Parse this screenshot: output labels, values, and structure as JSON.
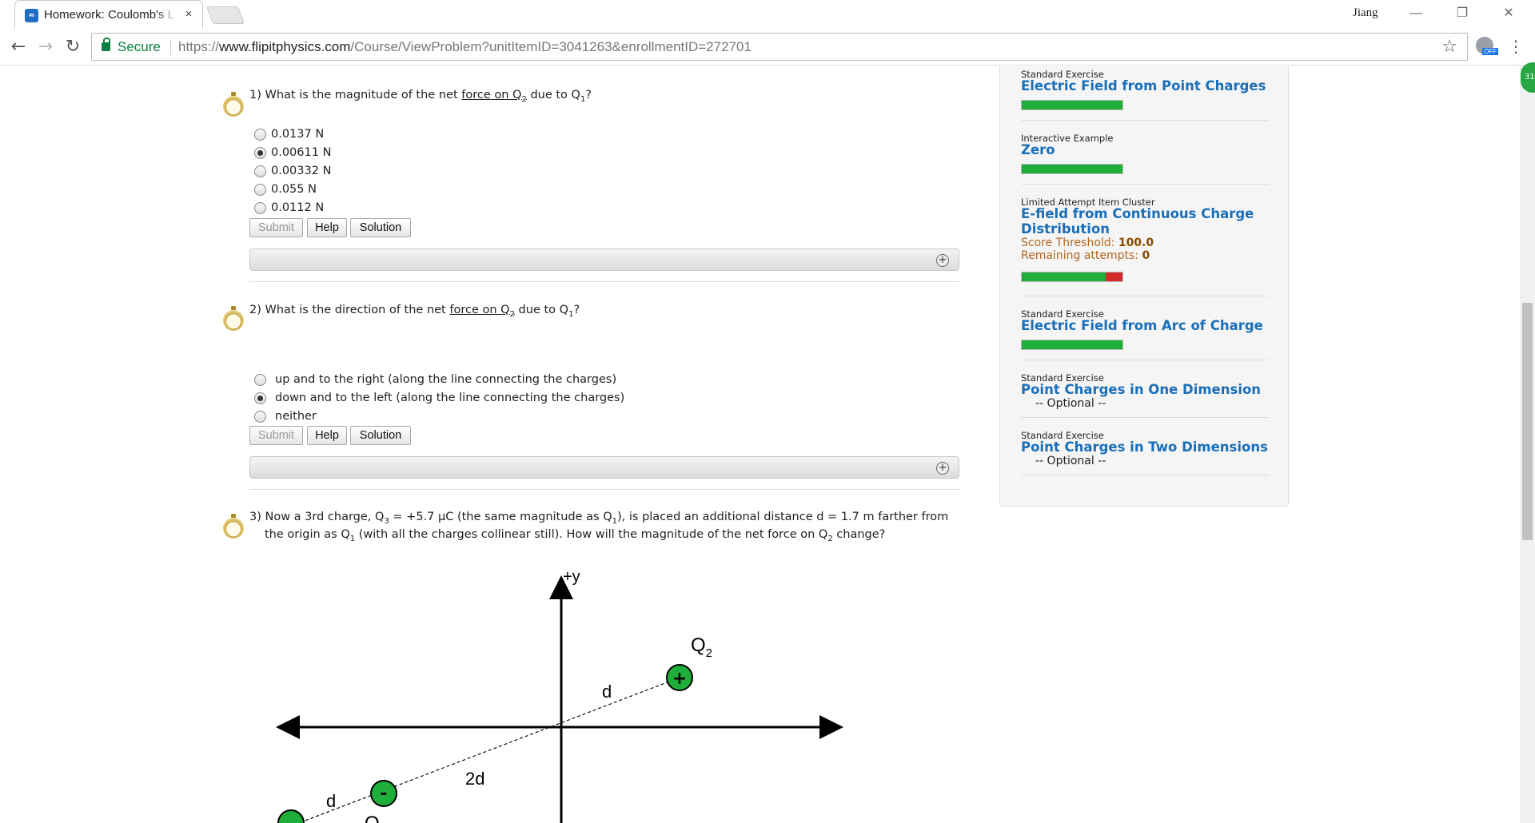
{
  "browser": {
    "tab_title": "Homework: Coulomb's L",
    "tab_close": "×",
    "user": "Jiang",
    "minimize": "—",
    "restore": "❐",
    "close": "✕",
    "secure_label": "Secure",
    "url_scheme": "https://",
    "url_host": "www.flipitphysics.com",
    "url_path": "/Course/ViewProblem?unitItemID=3041263&enrollmentID=272701",
    "extension_off": "OFF",
    "notification_count": "31"
  },
  "questions": [
    {
      "number": "1)",
      "text_pre": "What is the magnitude of the net ",
      "link": "force on Q",
      "link_sub": "2",
      "text_mid": " due to Q",
      "text_sub": "1",
      "text_post": "?",
      "options": [
        "0.0137 N",
        "0.00611 N",
        "0.00332 N",
        "0.055 N",
        "0.0112 N"
      ],
      "selected": 1
    },
    {
      "number": "2)",
      "text_pre": "What is the direction of the net ",
      "link": "force on Q",
      "link_sub": "2",
      "text_mid": " due to Q",
      "text_sub": "1",
      "text_post": "?",
      "options": [
        "up and to the right (along the line connecting the charges)",
        "down and to the left (along the line connecting the charges)",
        "neither"
      ],
      "selected": 1
    },
    {
      "number": "3)",
      "line1_a": "Now a 3rd charge, Q",
      "line1_sub1": "3",
      "line1_b": " = +5.7 μC (the same magnitude as Q",
      "line1_sub2": "1",
      "line1_c": "), is placed an additional distance d = 1.7 m farther from",
      "line2_a": "the origin as Q",
      "line2_sub1": "1",
      "line2_b": " (with all the charges collinear still). How will the magnitude of the net force on Q",
      "line2_sub2": "2",
      "line2_c": " change?"
    }
  ],
  "buttons": {
    "submit": "Submit",
    "help": "Help",
    "solution": "Solution"
  },
  "expander_icon": "+",
  "figure": {
    "y_label": "+y",
    "q2_label": "Q",
    "q2_sub": "2",
    "q2_sign": "+",
    "q1_sign": "-",
    "d_label_upper": "d",
    "two_d_label": "2d",
    "d_label_lower": "d",
    "q1_label": "Q"
  },
  "sidebar": {
    "items": [
      {
        "kind": "Standard Exercise",
        "title": "Electric Field from Point Charges",
        "progress": 1.0
      },
      {
        "kind": "Interactive Example",
        "title": "Zero",
        "progress": 1.0
      },
      {
        "kind": "Limited Attempt Item Cluster",
        "title": "E-field from Continuous Charge Distribution",
        "threshold_label": "Score Threshold:",
        "threshold_value": "100.0",
        "attempts_label": "Remaining attempts:",
        "attempts_value": "0",
        "progress": 0.83,
        "incorrect": 0.17
      },
      {
        "kind": "Standard Exercise",
        "title": "Electric Field from Arc of Charge",
        "progress": 1.0
      },
      {
        "kind": "Standard Exercise",
        "title": "Point Charges in One Dimension",
        "note": "-- Optional --"
      },
      {
        "kind": "Standard Exercise",
        "title": "Point Charges in Two Dimensions",
        "note": "-- Optional --"
      }
    ]
  },
  "colors": {
    "link_blue": "#1a6fb8",
    "progress_green": "#1fae3a",
    "progress_red": "#d42a2a",
    "charge_green": "#1fae3a",
    "meta_orange": "#b5651d"
  }
}
